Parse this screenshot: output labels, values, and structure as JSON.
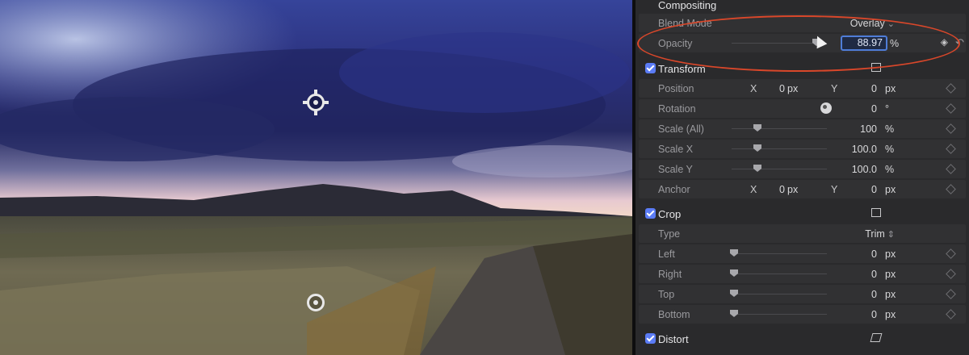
{
  "viewer": {
    "description_colors": {
      "sky": "#2e3a8c",
      "horizon": "#f0d8d0",
      "ground": "#6a6650",
      "road": "#4a4642"
    }
  },
  "inspector": {
    "compositing": {
      "header": "Compositing",
      "blend_mode_label": "Blend Mode",
      "blend_mode_value": "Overlay",
      "opacity_label": "Opacity",
      "opacity_value": "88.97",
      "opacity_unit": "%",
      "opacity_fraction": 0.89
    },
    "transform": {
      "header": "Transform",
      "position_label": "Position",
      "position_x_axis": "X",
      "position_x": "0",
      "position_x_unit": "px",
      "position_y_axis": "Y",
      "position_y": "0",
      "position_y_unit": "px",
      "rotation_label": "Rotation",
      "rotation_value": "0",
      "rotation_unit": "°",
      "scale_all_label": "Scale (All)",
      "scale_all_value": "100",
      "scale_all_unit": "%",
      "scale_x_label": "Scale X",
      "scale_x_value": "100.0",
      "scale_x_unit": "%",
      "scale_y_label": "Scale Y",
      "scale_y_value": "100.0",
      "scale_y_unit": "%",
      "anchor_label": "Anchor",
      "anchor_x_axis": "X",
      "anchor_x": "0",
      "anchor_x_unit": "px",
      "anchor_y_axis": "Y",
      "anchor_y": "0",
      "anchor_y_unit": "px"
    },
    "crop": {
      "header": "Crop",
      "type_label": "Type",
      "type_value": "Trim",
      "left_label": "Left",
      "left_value": "0",
      "left_unit": "px",
      "right_label": "Right",
      "right_value": "0",
      "right_unit": "px",
      "top_label": "Top",
      "top_value": "0",
      "top_unit": "px",
      "bottom_label": "Bottom",
      "bottom_value": "0",
      "bottom_unit": "px"
    },
    "distort": {
      "header": "Distort"
    }
  },
  "colors": {
    "accent": "#5b7cf6",
    "highlight": "#d9472a",
    "panel": "#2a2a2c"
  }
}
